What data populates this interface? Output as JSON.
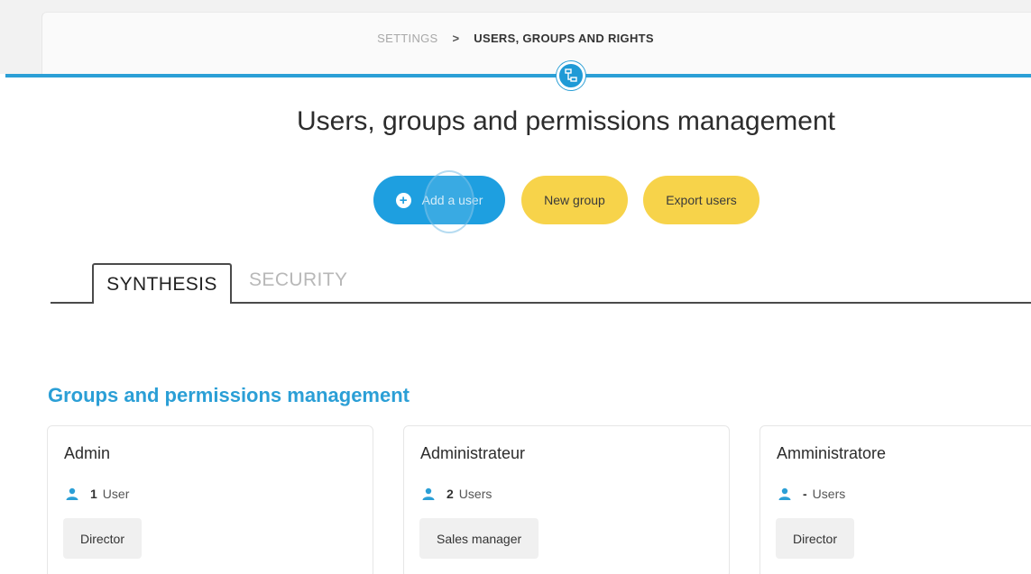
{
  "breadcrumb": {
    "settings": "SETTINGS",
    "separator": ">",
    "current": "USERS, GROUPS AND RIGHTS"
  },
  "header": {
    "center_icon": "org-chart-icon",
    "title": "Users, groups and permissions management"
  },
  "actions": {
    "add_user": "Add a user",
    "new_group": "New group",
    "export_users": "Export users"
  },
  "tabs": [
    {
      "label": "SYNTHESIS",
      "active": true
    },
    {
      "label": "SECURITY",
      "active": false
    }
  ],
  "section": {
    "title": "Groups and permissions management"
  },
  "groups": [
    {
      "name": "Admin",
      "count": "1",
      "unit": "User",
      "role": "Director"
    },
    {
      "name": "Administrateur",
      "count": "2",
      "unit": "Users",
      "role": "Sales manager"
    },
    {
      "name": "Amministratore",
      "count": "-",
      "unit": "Users",
      "role": "Director"
    }
  ],
  "colors": {
    "accent_blue": "#2b9fd6",
    "button_yellow": "#f7d34a",
    "button_blue": "#1e9fe0"
  }
}
